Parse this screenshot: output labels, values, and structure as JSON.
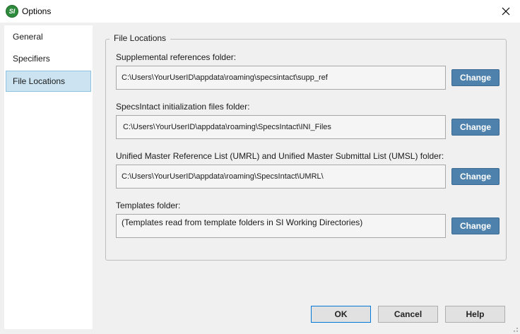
{
  "window": {
    "title": "Options",
    "logo_text": "SI"
  },
  "sidebar": {
    "items": [
      {
        "label": "General"
      },
      {
        "label": "Specifiers"
      },
      {
        "label": "File Locations"
      }
    ]
  },
  "file_locations": {
    "group_title": "File Locations",
    "fields": [
      {
        "label": "Supplemental references folder:",
        "value": "C:\\Users\\YourUserID\\appdata\\roaming\\specsintact\\supp_ref",
        "button": "Change"
      },
      {
        "label": "SpecsIntact initialization files folder:",
        "value": "C:\\Users\\YourUserID\\appdata\\roaming\\SpecsIntact\\INI_Files",
        "button": "Change"
      },
      {
        "label": "Unified Master Reference List (UMRL) and Unified Master Submittal List (UMSL) folder:",
        "value": "C:\\Users\\YourUserID\\appdata\\roaming\\SpecsIntact\\UMRL\\",
        "button": "Change"
      },
      {
        "label": "Templates folder:",
        "value": "(Templates read from template folders in SI Working Directories)",
        "button": "Change"
      }
    ]
  },
  "footer": {
    "ok": "OK",
    "cancel": "Cancel",
    "help": "Help"
  }
}
